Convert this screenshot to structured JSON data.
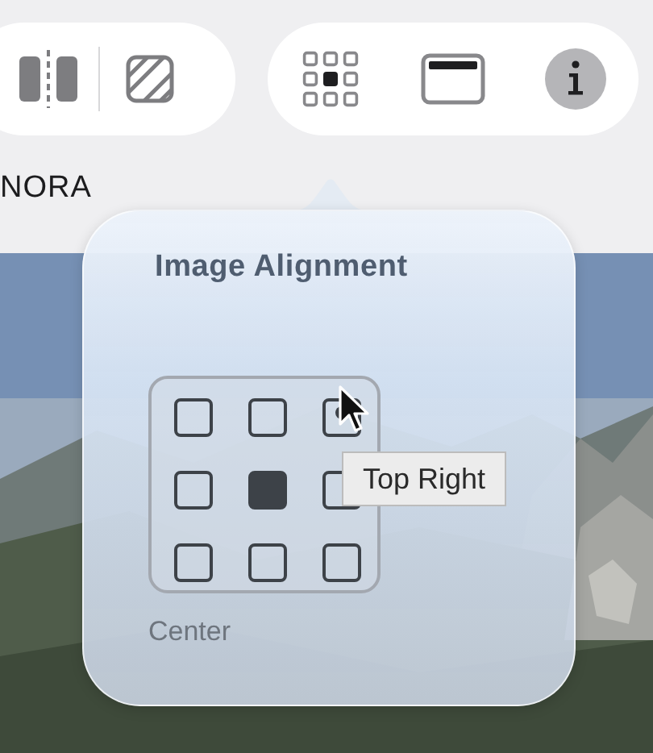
{
  "toolbar": {
    "groups": [
      {
        "buttons": [
          {
            "kind": "split"
          },
          {
            "kind": "hatch"
          }
        ]
      },
      {
        "buttons": [
          {
            "kind": "grid",
            "selected": true
          },
          {
            "kind": "window"
          },
          {
            "kind": "info"
          }
        ]
      }
    ]
  },
  "heading_text": "NORA",
  "popover": {
    "title": "Image Alignment",
    "cells": [
      {
        "selected": false,
        "hovered": false
      },
      {
        "selected": false,
        "hovered": false
      },
      {
        "selected": false,
        "hovered": true
      },
      {
        "selected": false,
        "hovered": false
      },
      {
        "selected": true,
        "hovered": false
      },
      {
        "selected": false,
        "hovered": false
      },
      {
        "selected": false,
        "hovered": false
      },
      {
        "selected": false,
        "hovered": false
      },
      {
        "selected": false,
        "hovered": false
      }
    ],
    "value_label": "Center"
  },
  "tooltip": "Top Right"
}
